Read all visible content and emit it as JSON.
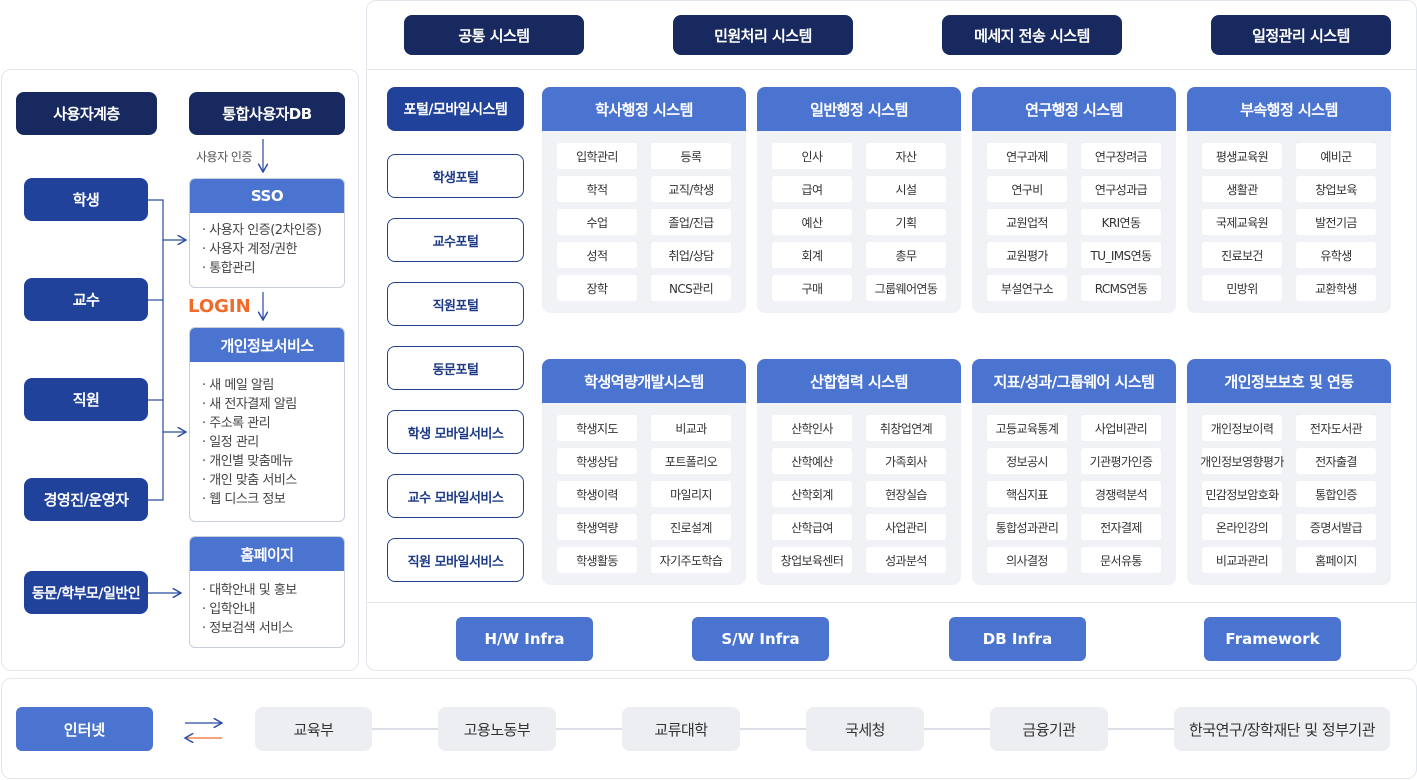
{
  "top_systems": [
    "공통 시스템",
    "민원처리 시스템",
    "메세지 전송 시스템",
    "일정관리 시스템"
  ],
  "left": {
    "user_layer": "사용자계층",
    "db": "통합사용자DB",
    "auth_label": "사용자 인증",
    "login_label": "LOGIN",
    "users": [
      "학생",
      "교수",
      "직원",
      "경영진/운영자",
      "동문/학부모/일반인"
    ],
    "sso": {
      "title": "SSO",
      "items": [
        "사용자 인증(2차인증)",
        "사용자 계정/권한",
        "통합관리"
      ]
    },
    "privacy": {
      "title": "개인정보서비스",
      "items": [
        "새 메일 알림",
        "새 전자결제 알림",
        "주소록 관리",
        "일정 관리",
        "개인별 맞춤메뉴",
        "개인 맞춤 서비스",
        "웹 디스크 정보"
      ]
    },
    "homepage": {
      "title": "홈페이지",
      "items": [
        "대학안내 및 홍보",
        "입학안내",
        "정보검색 서비스"
      ]
    }
  },
  "portal": {
    "header": "포털/모바일시스템",
    "items": [
      "학생포털",
      "교수포털",
      "직원포털",
      "동문포털",
      "학생 모바일서비스",
      "교수 모바일서비스",
      "직원 모바일서비스"
    ]
  },
  "systems": [
    {
      "title": "학사행정 시스템",
      "items": [
        "입학관리",
        "등록",
        "학적",
        "교직/학생",
        "수업",
        "졸업/진급",
        "성적",
        "취업/상담",
        "장학",
        "NCS관리"
      ]
    },
    {
      "title": "일반행정 시스템",
      "items": [
        "인사",
        "자산",
        "급여",
        "시설",
        "예산",
        "기획",
        "회계",
        "총무",
        "구매",
        "그룹웨어연동"
      ]
    },
    {
      "title": "연구행정 시스템",
      "items": [
        "연구과제",
        "연구장려금",
        "연구비",
        "연구성과급",
        "교원업적",
        "KRI연동",
        "교원평가",
        "TU_IMS연동",
        "부설연구소",
        "RCMS연동"
      ]
    },
    {
      "title": "부속행정 시스템",
      "items": [
        "평생교육원",
        "예비군",
        "생활관",
        "창업보육",
        "국제교육원",
        "발전기금",
        "진료보건",
        "유학생",
        "민방위",
        "교환학생"
      ]
    },
    {
      "title": "학생역량개발시스템",
      "items": [
        "학생지도",
        "비교과",
        "학생상담",
        "포트폴리오",
        "학생이력",
        "마일리지",
        "학생역량",
        "진로설계",
        "학생활동",
        "자기주도학습"
      ]
    },
    {
      "title": "산합협력 시스템",
      "items": [
        "산학인사",
        "취창업연계",
        "산학예산",
        "가족회사",
        "산학회계",
        "현장실습",
        "산학급여",
        "사업관리",
        "창업보육센터",
        "성과분석"
      ]
    },
    {
      "title": "지표/성과/그룹웨어 시스템",
      "items": [
        "고등교육통계",
        "사업비관리",
        "정보공시",
        "기관평가인증",
        "핵심지표",
        "경쟁력분석",
        "통합성과관리",
        "전자결제",
        "의사결정",
        "문서유통"
      ]
    },
    {
      "title": "개인정보보호 및 연동",
      "items": [
        "개인정보이력",
        "전자도서관",
        "개인정보영향평가",
        "전자출결",
        "민감정보암호화",
        "통합인증",
        "온라인강의",
        "증명서발급",
        "비교과관리",
        "홈페이지"
      ]
    }
  ],
  "infra": [
    "H/W Infra",
    "S/W Infra",
    "DB Infra",
    "Framework"
  ],
  "bottom": {
    "internet": "인터넷",
    "orgs": [
      "교육부",
      "고용노동부",
      "교류대학",
      "국세청",
      "금융기관",
      "한국연구/장학재단 및 정부기관"
    ]
  },
  "colors": {
    "navy": "#17295e",
    "blue": "#20429a",
    "mid_blue": "#4a74cf",
    "accent_orange": "#f06a2a"
  }
}
